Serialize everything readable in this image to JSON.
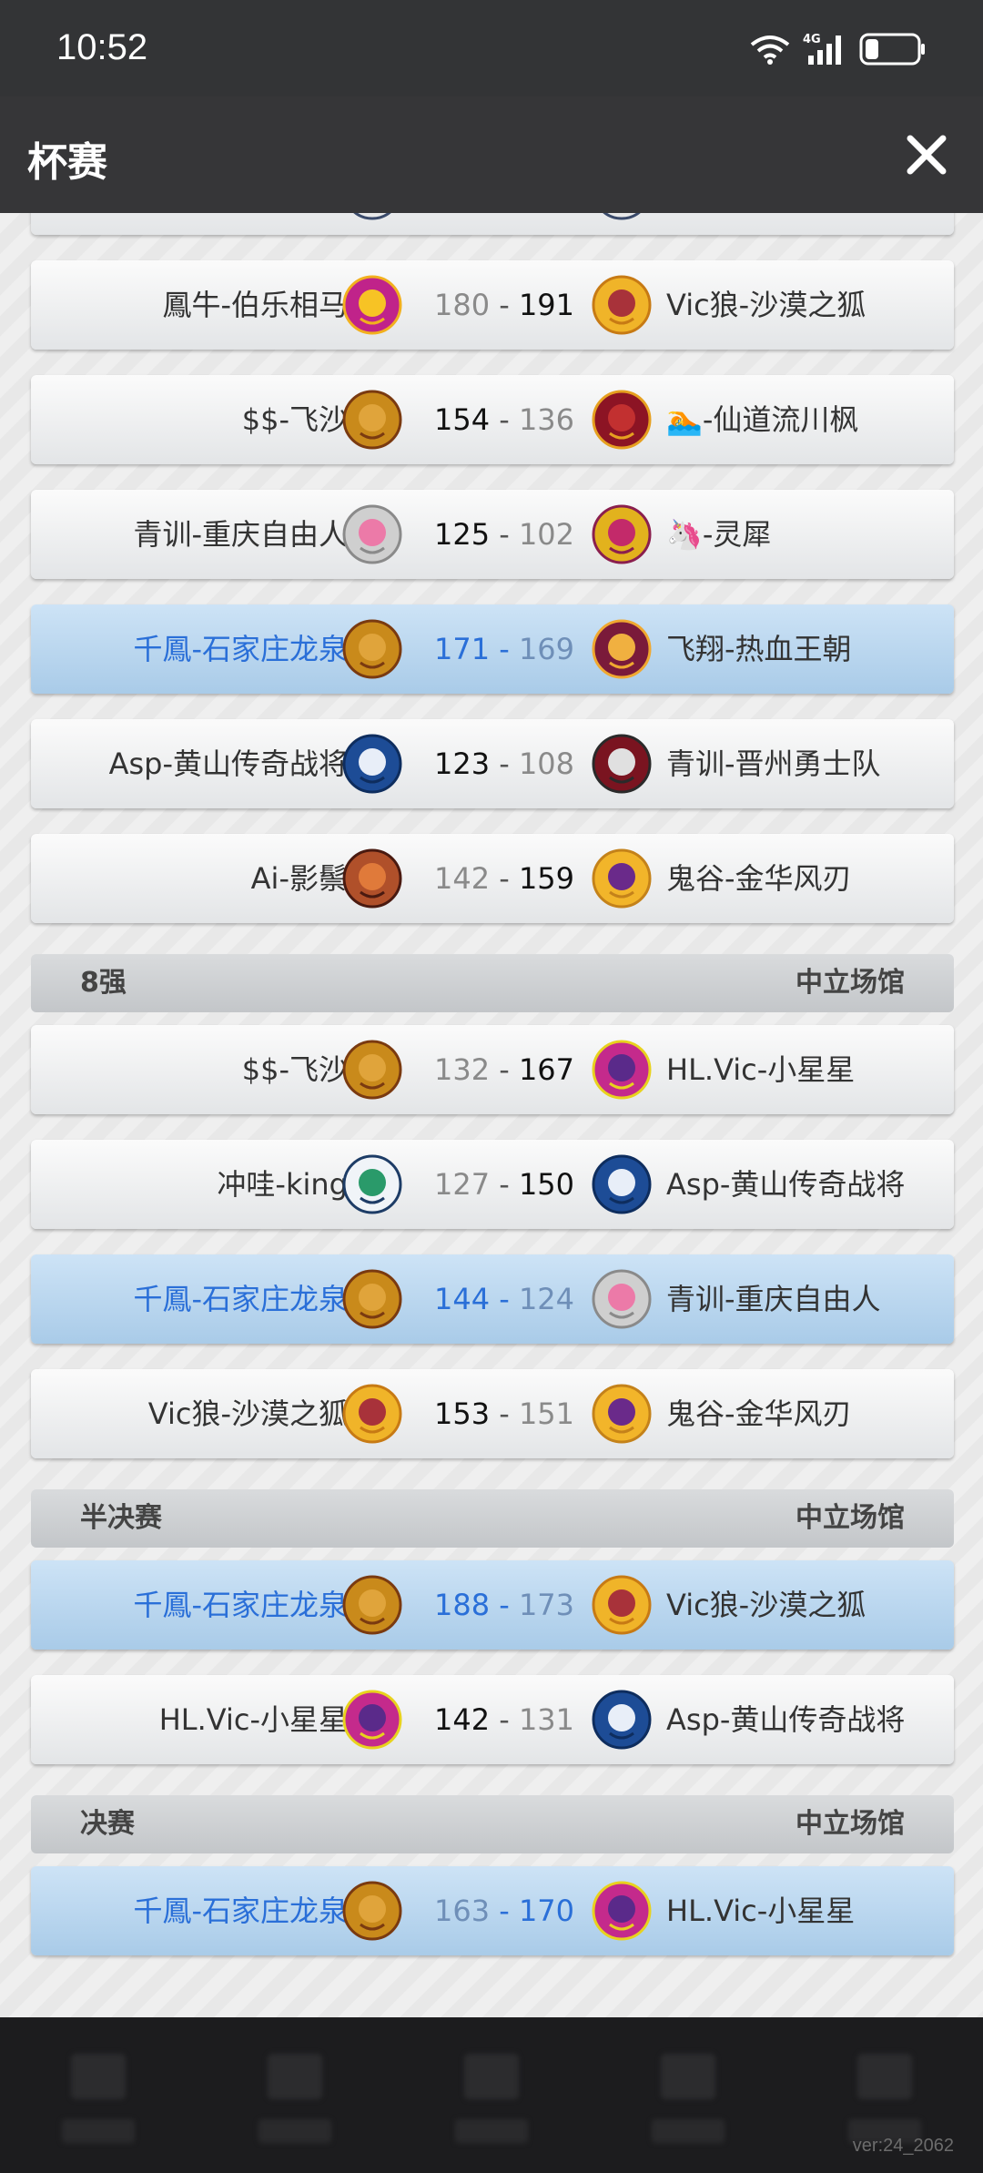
{
  "status_bar": {
    "time": "10:52",
    "network": "4G"
  },
  "header": {
    "title": "杯赛"
  },
  "colors": {
    "highlight_text": "#2a6fd8",
    "header_bg": "#363638"
  },
  "rounds": [
    {
      "name": "",
      "venue": "",
      "matches": [
        {
          "home": "",
          "home_score": "",
          "away_score": "",
          "away": "",
          "highlight": false,
          "home_logo": "logo-partial",
          "away_logo": "logo-partial"
        },
        {
          "home": "鳳牛-伯乐相马",
          "home_score": "180",
          "away_score": "191",
          "away": "Vic狼-沙漠之狐",
          "highlight": false,
          "home_logo": "wheel-logo",
          "away_logo": "fox-logo"
        },
        {
          "home": "$$-飞沙",
          "home_score": "154",
          "away_score": "136",
          "away": "🏊-仙道流川枫",
          "highlight": false,
          "home_logo": "lion-logo",
          "away_logo": "warthog-logo"
        },
        {
          "home": "青训-重庆自由人",
          "home_score": "125",
          "away_score": "102",
          "away": "🦄-灵犀",
          "highlight": false,
          "home_logo": "pig-logo",
          "away_logo": "dragon-logo"
        },
        {
          "home": "千鳳-石家庄龙泉",
          "home_score": "171",
          "away_score": "169",
          "away": "飞翔-热血王朝",
          "highlight": true,
          "home_logo": "lion-logo",
          "away_logo": "beast-logo"
        },
        {
          "home": "Asp-黄山传奇战将",
          "home_score": "123",
          "away_score": "108",
          "away": "青训-晋州勇士队",
          "highlight": false,
          "home_logo": "unicorn-logo",
          "away_logo": "spartan-logo"
        },
        {
          "home": "Ai-影鬃",
          "home_score": "142",
          "away_score": "159",
          "away": "鬼谷-金华风刃",
          "highlight": false,
          "home_logo": "boar-logo",
          "away_logo": "rocket-logo"
        }
      ]
    },
    {
      "name": "8强",
      "venue": "中立场馆",
      "matches": [
        {
          "home": "$$-飞沙",
          "home_score": "132",
          "away_score": "167",
          "away": "HL.Vic-小星星",
          "highlight": false,
          "home_logo": "lion-logo",
          "away_logo": "dragon-shield-logo"
        },
        {
          "home": "冲哇-king",
          "home_score": "127",
          "away_score": "150",
          "away": "Asp-黄山传奇战将",
          "highlight": false,
          "home_logo": "dino-shield-logo",
          "away_logo": "unicorn-logo"
        },
        {
          "home": "千鳳-石家庄龙泉",
          "home_score": "144",
          "away_score": "124",
          "away": "青训-重庆自由人",
          "highlight": true,
          "home_logo": "lion-logo",
          "away_logo": "pig-logo"
        },
        {
          "home": "Vic狼-沙漠之狐",
          "home_score": "153",
          "away_score": "151",
          "away": "鬼谷-金华风刃",
          "highlight": false,
          "home_logo": "fox-logo",
          "away_logo": "rocket-logo"
        }
      ]
    },
    {
      "name": "半决赛",
      "venue": "中立场馆",
      "matches": [
        {
          "home": "千鳳-石家庄龙泉",
          "home_score": "188",
          "away_score": "173",
          "away": "Vic狼-沙漠之狐",
          "highlight": true,
          "home_logo": "lion-logo",
          "away_logo": "fox-logo"
        },
        {
          "home": "HL.Vic-小星星",
          "home_score": "142",
          "away_score": "131",
          "away": "Asp-黄山传奇战将",
          "highlight": false,
          "home_logo": "dragon-shield-logo",
          "away_logo": "unicorn-logo"
        }
      ]
    },
    {
      "name": "决赛",
      "venue": "中立场馆",
      "matches": [
        {
          "home": "千鳳-石家庄龙泉",
          "home_score": "163",
          "away_score": "170",
          "away": "HL.Vic-小星星",
          "highlight": true,
          "home_logo": "lion-logo",
          "away_logo": "dragon-shield-logo"
        }
      ]
    }
  ],
  "footer": {
    "version": "ver:24_2062"
  }
}
